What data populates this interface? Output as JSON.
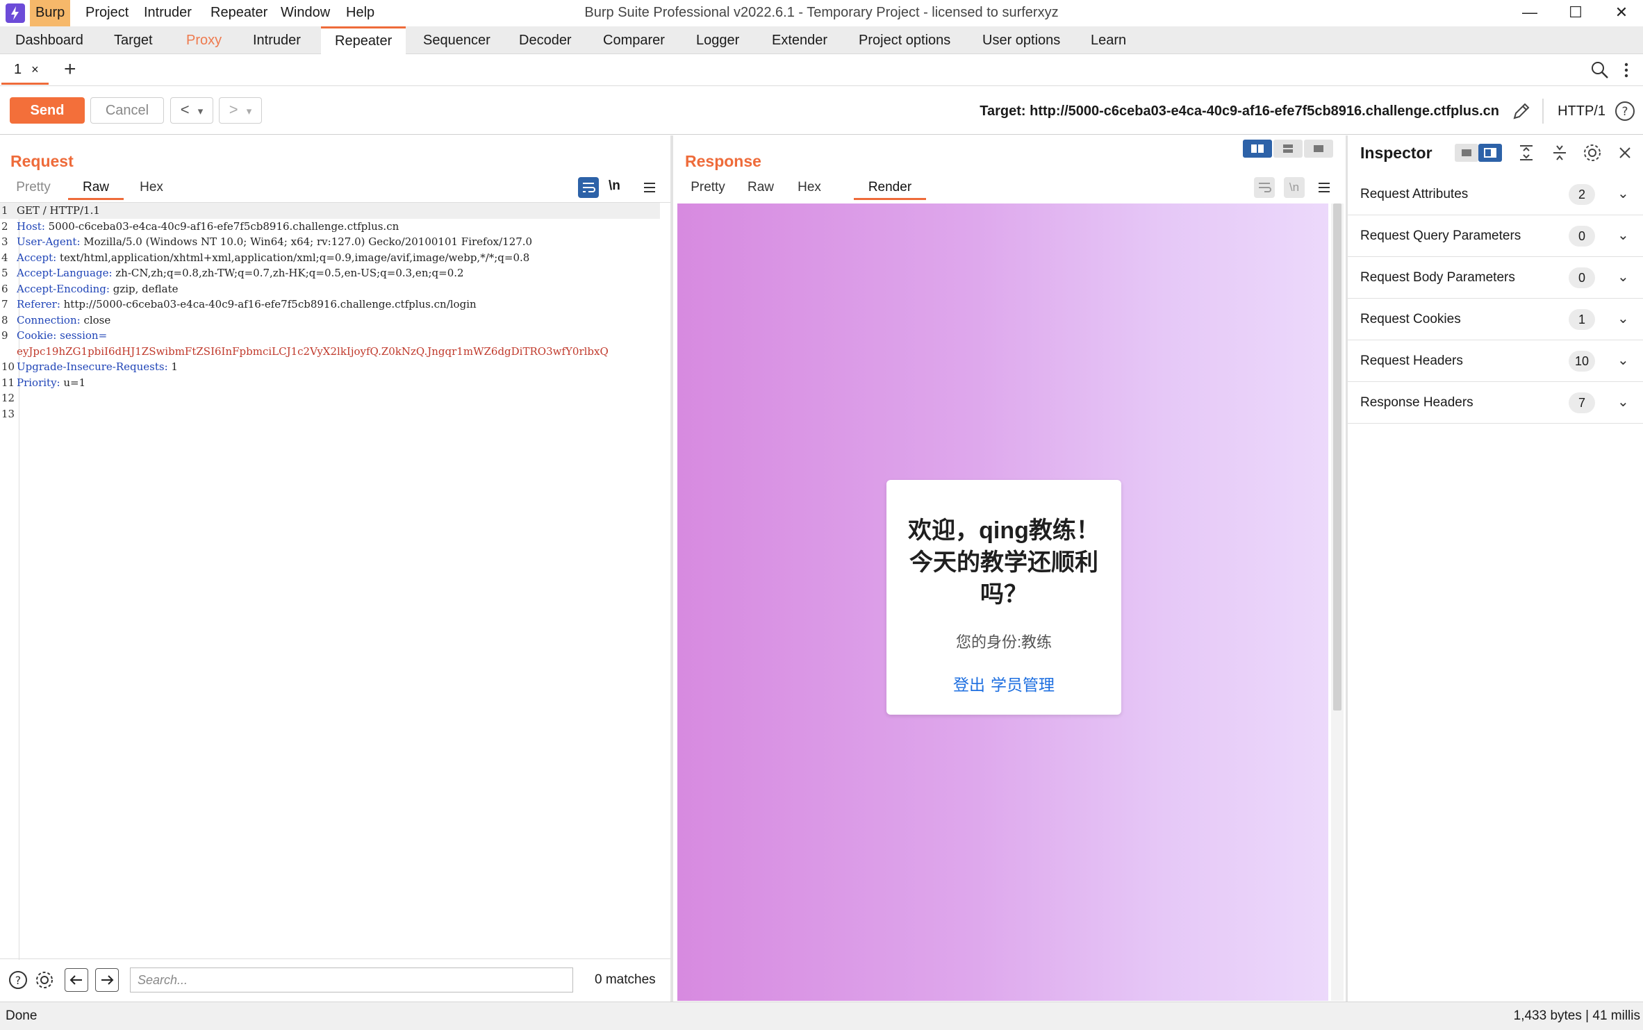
{
  "app": {
    "menu": [
      "Burp",
      "Project",
      "Intruder",
      "Repeater",
      "Window",
      "Help"
    ],
    "window_title": "Burp Suite Professional v2022.6.1 - Temporary Project - licensed to surferxyz"
  },
  "main_tabs": [
    "Dashboard",
    "Target",
    "Proxy",
    "Intruder",
    "Repeater",
    "Sequencer",
    "Decoder",
    "Comparer",
    "Logger",
    "Extender",
    "Project options",
    "User options",
    "Learn"
  ],
  "repeater_tab": {
    "label": "1",
    "close": "×",
    "add": "+"
  },
  "toolbar": {
    "send_label": "Send",
    "cancel_label": "Cancel",
    "back": "<",
    "forward": ">",
    "dropdown": "▾",
    "target": "Target: http://5000-c6ceba03-e4ca-40c9-af16-efe7f5cb8916.challenge.ctfplus.cn",
    "http_version": "HTTP/1"
  },
  "request": {
    "title": "Request",
    "tabs": [
      "Pretty",
      "Raw",
      "Hex"
    ],
    "newline_toggle": "\\n",
    "lines": [
      {
        "n": "1",
        "key": "",
        "val": "GET / HTTP/1.1"
      },
      {
        "n": "2",
        "key": "Host:",
        "val": " 5000-c6ceba03-e4ca-40c9-af16-efe7f5cb8916.challenge.ctfplus.cn"
      },
      {
        "n": "3",
        "key": "User-Agent:",
        "val": " Mozilla/5.0 (Windows NT 10.0; Win64; x64; rv:127.0) Gecko/20100101 Firefox/127.0"
      },
      {
        "n": "4",
        "key": "Accept:",
        "val": " text/html,application/xhtml+xml,application/xml;q=0.9,image/avif,image/webp,*/*;q=0.8"
      },
      {
        "n": "5",
        "key": "Accept-Language:",
        "val": " zh-CN,zh;q=0.8,zh-TW;q=0.7,zh-HK;q=0.5,en-US;q=0.3,en;q=0.2"
      },
      {
        "n": "6",
        "key": "Accept-Encoding:",
        "val": " gzip, deflate"
      },
      {
        "n": "7",
        "key": "Referer:",
        "val": " http://5000-c6ceba03-e4ca-40c9-af16-efe7f5cb8916.challenge.ctfplus.cn/login"
      },
      {
        "n": "8",
        "key": "Connection:",
        "val": " close"
      },
      {
        "n": "9",
        "key": "Cookie:",
        "val": " session="
      },
      {
        "n": "",
        "key": "",
        "val": "eyJpc19hZG1pbiI6dHJ1ZSwibmFtZSI6InFpbmciLCJ1c2VyX2lkIjoyfQ.Z0kNzQ.Jngqr1mWZ6dgDiTRO3wfY0rlbxQ"
      },
      {
        "n": "10",
        "key": "Upgrade-Insecure-Requests:",
        "val": " 1"
      },
      {
        "n": "11",
        "key": "Priority:",
        "val": " u=1"
      },
      {
        "n": "12",
        "key": "",
        "val": ""
      },
      {
        "n": "13",
        "key": "",
        "val": ""
      }
    ],
    "search_placeholder": "Search...",
    "matches": "0 matches"
  },
  "response": {
    "title": "Response",
    "tabs": [
      "Pretty",
      "Raw",
      "Hex",
      "Render"
    ],
    "newline_toggle": "\\n",
    "render": {
      "heading": "欢迎，qing教练！今天的教学还顺利吗？",
      "role": "您的身份:教练",
      "links": [
        "登出",
        "学员管理"
      ]
    }
  },
  "inspector": {
    "title": "Inspector",
    "sections": [
      {
        "label": "Request Attributes",
        "count": "2"
      },
      {
        "label": "Request Query Parameters",
        "count": "0"
      },
      {
        "label": "Request Body Parameters",
        "count": "0"
      },
      {
        "label": "Request Cookies",
        "count": "1"
      },
      {
        "label": "Request Headers",
        "count": "10"
      },
      {
        "label": "Response Headers",
        "count": "7"
      }
    ]
  },
  "status": {
    "left": "Done",
    "right": "1,433 bytes | 41 millis"
  },
  "colors": {
    "accent": "#ee6b3a",
    "send": "#f36f3a",
    "link": "#1e6fe0",
    "header_key": "#1f44b7",
    "cookie_value": "#c0392b"
  },
  "icons": [
    "burp-logo-icon",
    "minimize-icon",
    "maximize-icon",
    "close-icon",
    "search-icon",
    "kebab-menu-icon",
    "pencil-icon",
    "help-icon",
    "wrap-icon",
    "hamburger-icon",
    "layout-icon",
    "settings-icon",
    "expand-icon",
    "collapse-icon",
    "arrow-left-icon",
    "arrow-right-icon",
    "chevron-down-icon"
  ]
}
